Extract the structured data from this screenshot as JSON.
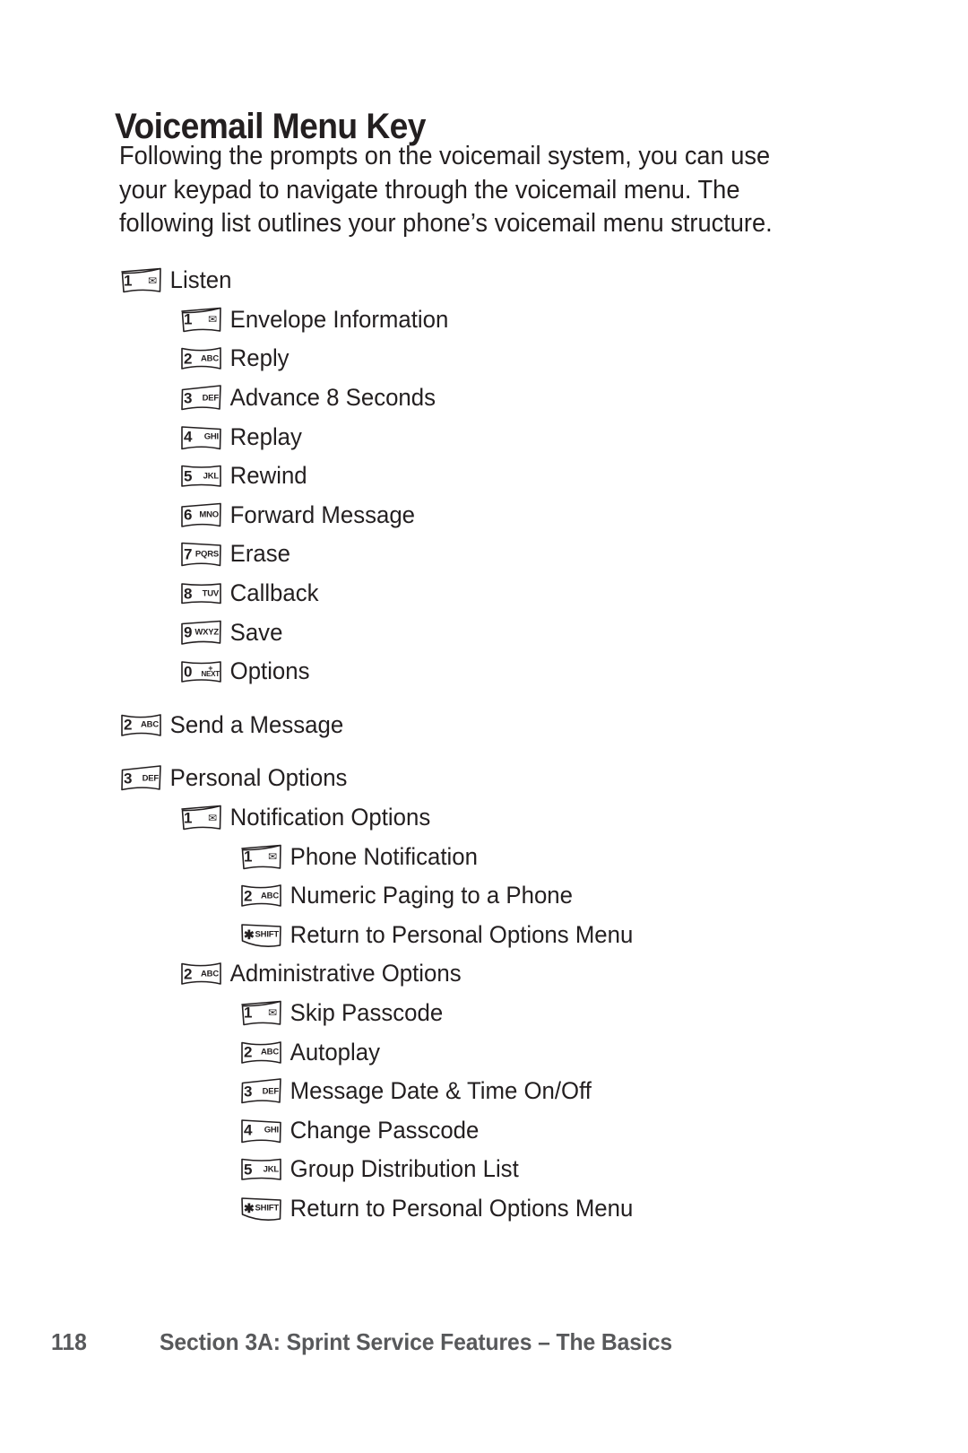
{
  "page": {
    "heading": "Voicemail Menu Key",
    "intro_lines": [
      "Following the prompts on the voicemail system, you can use",
      "your keypad to navigate through the voicemail menu. The",
      "following list outlines your phone’s voicemail menu structure."
    ],
    "text_color": "#231f20",
    "footer_color": "#58595b",
    "background": "#ffffff"
  },
  "footer": {
    "page_number": "118",
    "section": "Section 3A: Sprint Service Features – The Basics"
  },
  "menu": [
    {
      "level": 0,
      "key": {
        "digit": "1",
        "sub": "✉",
        "type": "envelope",
        "icon": "key-1-envelope-icon"
      },
      "label": "Listen",
      "gap": false
    },
    {
      "level": 1,
      "key": {
        "digit": "1",
        "sub": "✉",
        "type": "envelope",
        "icon": "key-1-envelope-icon"
      },
      "label": "Envelope Information",
      "gap": false
    },
    {
      "level": 1,
      "key": {
        "digit": "2",
        "sub": "ABC",
        "type": "letters",
        "icon": "key-2-abc-icon"
      },
      "label": "Reply",
      "gap": false
    },
    {
      "level": 1,
      "key": {
        "digit": "3",
        "sub": "DEF",
        "type": "letters",
        "icon": "key-3-def-icon"
      },
      "label": "Advance 8 Seconds",
      "gap": false
    },
    {
      "level": 1,
      "key": {
        "digit": "4",
        "sub": "GHI",
        "type": "letters",
        "icon": "key-4-ghi-icon"
      },
      "label": "Replay",
      "gap": false
    },
    {
      "level": 1,
      "key": {
        "digit": "5",
        "sub": "JKL",
        "type": "letters",
        "icon": "key-5-jkl-icon"
      },
      "label": "Rewind",
      "gap": false
    },
    {
      "level": 1,
      "key": {
        "digit": "6",
        "sub": "MNO",
        "type": "letters",
        "icon": "key-6-mno-icon"
      },
      "label": "Forward Message",
      "gap": false
    },
    {
      "level": 1,
      "key": {
        "digit": "7",
        "sub": "PQRS",
        "type": "letters",
        "icon": "key-7-pqrs-icon"
      },
      "label": "Erase",
      "gap": false
    },
    {
      "level": 1,
      "key": {
        "digit": "8",
        "sub": "TUV",
        "type": "letters",
        "icon": "key-8-tuv-icon"
      },
      "label": "Callback",
      "gap": false
    },
    {
      "level": 1,
      "key": {
        "digit": "9",
        "sub": "WXYZ",
        "type": "letters",
        "icon": "key-9-wxyz-icon"
      },
      "label": "Save",
      "gap": false
    },
    {
      "level": 1,
      "key": {
        "digit": "0",
        "sub": "+ NEXT",
        "type": "stacked",
        "icon": "key-0-next-icon"
      },
      "label": "Options",
      "gap": false
    },
    {
      "level": 0,
      "key": {
        "digit": "2",
        "sub": "ABC",
        "type": "letters",
        "icon": "key-2-abc-icon"
      },
      "label": "Send a Message",
      "gap": true
    },
    {
      "level": 0,
      "key": {
        "digit": "3",
        "sub": "DEF",
        "type": "letters",
        "icon": "key-3-def-icon"
      },
      "label": "Personal Options",
      "gap": true
    },
    {
      "level": 1,
      "key": {
        "digit": "1",
        "sub": "✉",
        "type": "envelope",
        "icon": "key-1-envelope-icon"
      },
      "label": "Notification Options",
      "gap": false
    },
    {
      "level": 2,
      "key": {
        "digit": "1",
        "sub": "✉",
        "type": "envelope",
        "icon": "key-1-envelope-icon"
      },
      "label": "Phone Notification",
      "gap": false
    },
    {
      "level": 2,
      "key": {
        "digit": "2",
        "sub": "ABC",
        "type": "letters",
        "icon": "key-2-abc-icon"
      },
      "label": "Numeric Paging to a Phone",
      "gap": false
    },
    {
      "level": 2,
      "key": {
        "digit": "✱",
        "sub": "SHIFT",
        "type": "star",
        "icon": "key-star-shift-icon"
      },
      "label": "Return to Personal Options Menu",
      "gap": false
    },
    {
      "level": 1,
      "key": {
        "digit": "2",
        "sub": "ABC",
        "type": "letters",
        "icon": "key-2-abc-icon"
      },
      "label": "Administrative Options",
      "gap": false
    },
    {
      "level": 2,
      "key": {
        "digit": "1",
        "sub": "✉",
        "type": "envelope",
        "icon": "key-1-envelope-icon"
      },
      "label": "Skip Passcode",
      "gap": false
    },
    {
      "level": 2,
      "key": {
        "digit": "2",
        "sub": "ABC",
        "type": "letters",
        "icon": "key-2-abc-icon"
      },
      "label": "Autoplay",
      "gap": false
    },
    {
      "level": 2,
      "key": {
        "digit": "3",
        "sub": "DEF",
        "type": "letters",
        "icon": "key-3-def-icon"
      },
      "label": "Message Date & Time On/Off",
      "gap": false
    },
    {
      "level": 2,
      "key": {
        "digit": "4",
        "sub": "GHI",
        "type": "letters",
        "icon": "key-4-ghi-icon"
      },
      "label": "Change Passcode",
      "gap": false
    },
    {
      "level": 2,
      "key": {
        "digit": "5",
        "sub": "JKL",
        "type": "letters",
        "icon": "key-5-jkl-icon"
      },
      "label": "Group Distribution List",
      "gap": false
    },
    {
      "level": 2,
      "key": {
        "digit": "✱",
        "sub": "SHIFT",
        "type": "star",
        "icon": "key-star-shift-icon"
      },
      "label": "Return to Personal Options Menu",
      "gap": false
    }
  ]
}
